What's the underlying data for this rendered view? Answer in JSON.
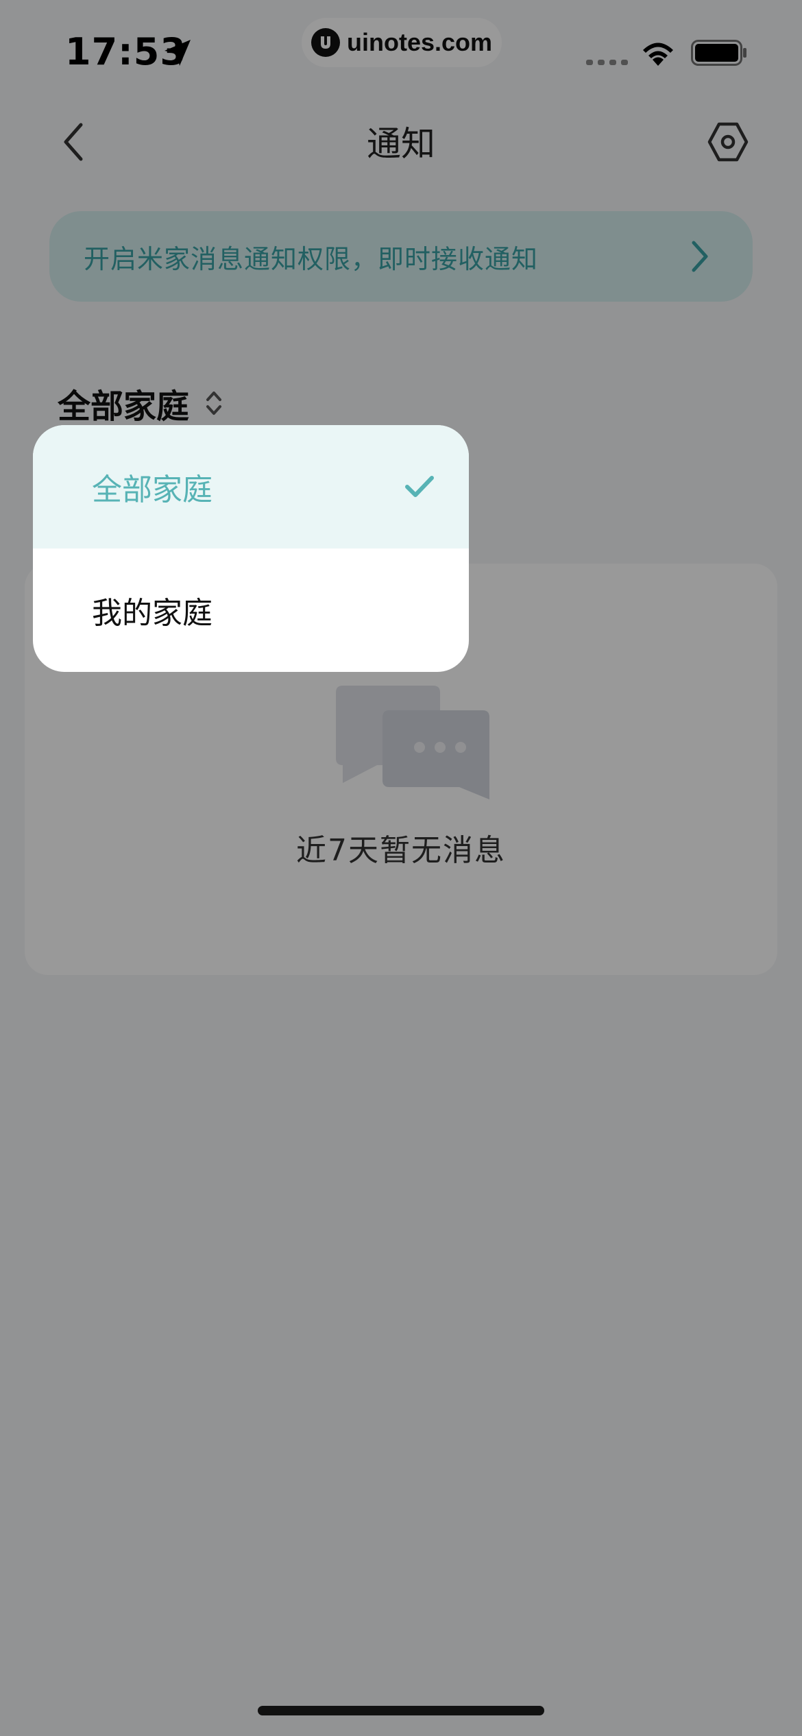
{
  "status_bar": {
    "time": "17:53",
    "watermark": "uinotes.com"
  },
  "nav": {
    "title": "通知",
    "back_icon": "chevron-left-icon",
    "settings_icon": "hexagon-settings-icon"
  },
  "banner": {
    "text": "开启米家消息通知权限，即时接收通知",
    "icon": "chevron-right-icon"
  },
  "filter": {
    "selected_label": "全部家庭",
    "icon": "sort-up-down-icon"
  },
  "dropdown": {
    "items": [
      {
        "label": "全部家庭",
        "selected": true
      },
      {
        "label": "我的家庭",
        "selected": false
      }
    ]
  },
  "empty_state": {
    "text": "近7天暂无消息",
    "icon": "chat-bubbles-icon"
  },
  "colors": {
    "accent": "#57b3b5",
    "banner_bg": "#d4eded",
    "banner_text": "#3aa0a3",
    "selected_bg": "#eaf6f6",
    "overlay": "rgba(0,0,0,0.40)"
  }
}
